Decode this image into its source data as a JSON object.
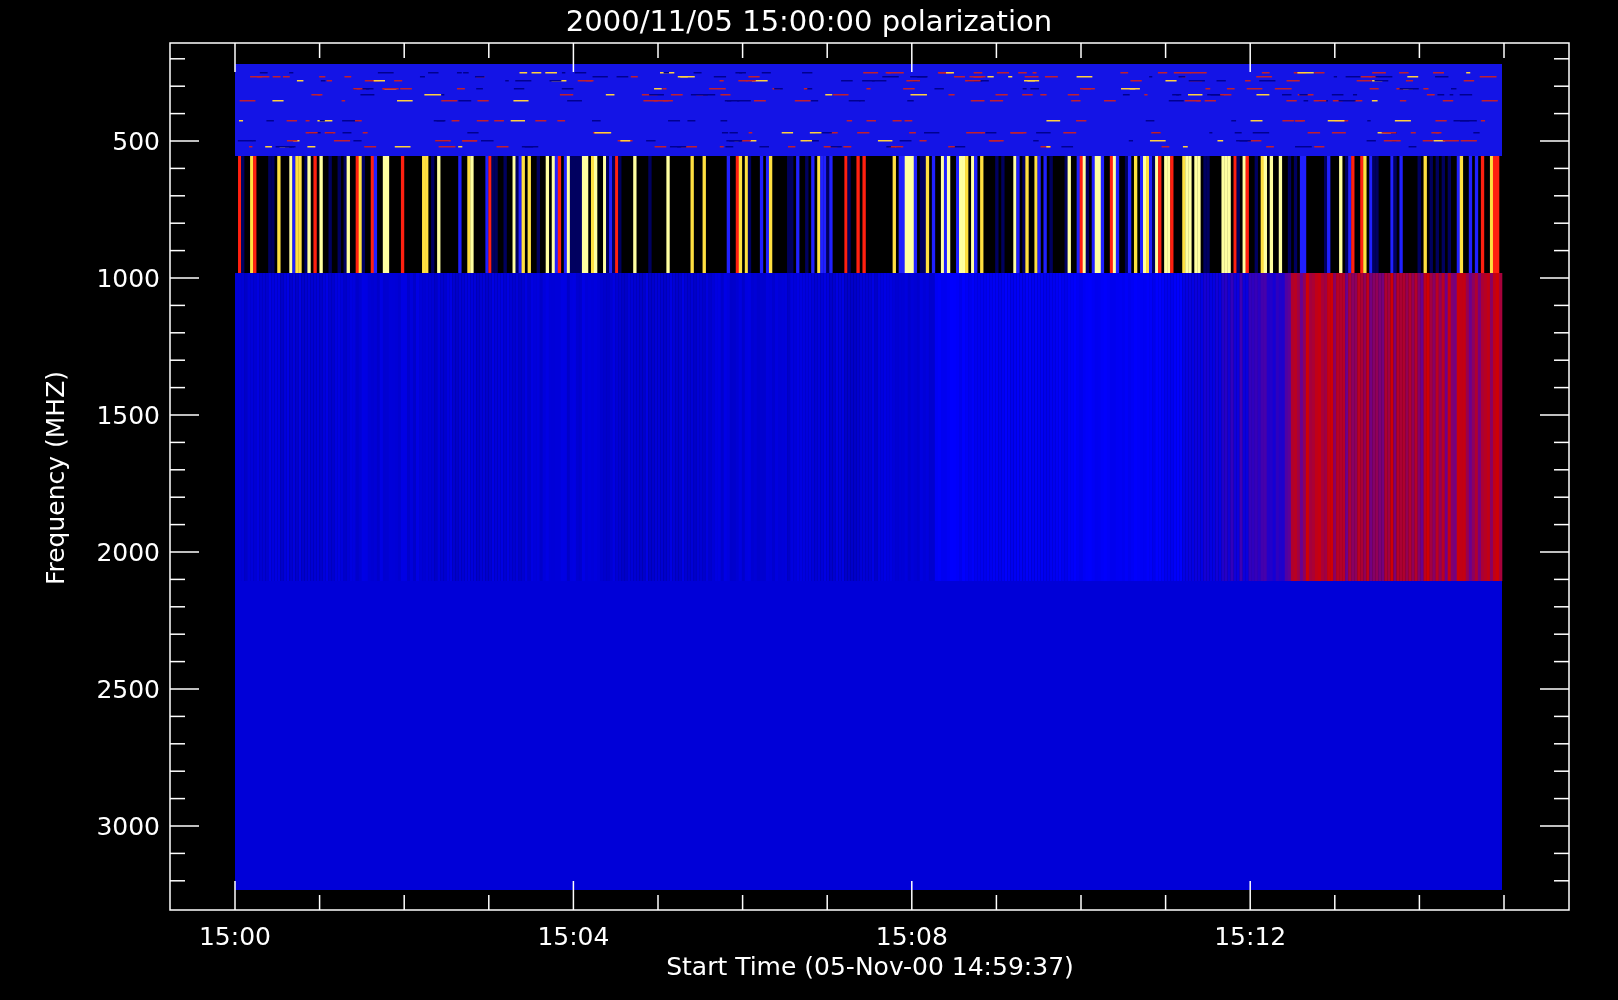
{
  "title": "2000/11/05 15:00:00 polarization",
  "plot": {
    "ylabel": "Frequency (MHZ)",
    "xlabel": "Start Time (05-Nov-00 14:59:37)",
    "yticks": [
      "500",
      "1000",
      "1500",
      "2000",
      "2500",
      "3000"
    ],
    "xticks": [
      "15:00",
      "15:04",
      "15:08",
      "15:12"
    ]
  }
}
